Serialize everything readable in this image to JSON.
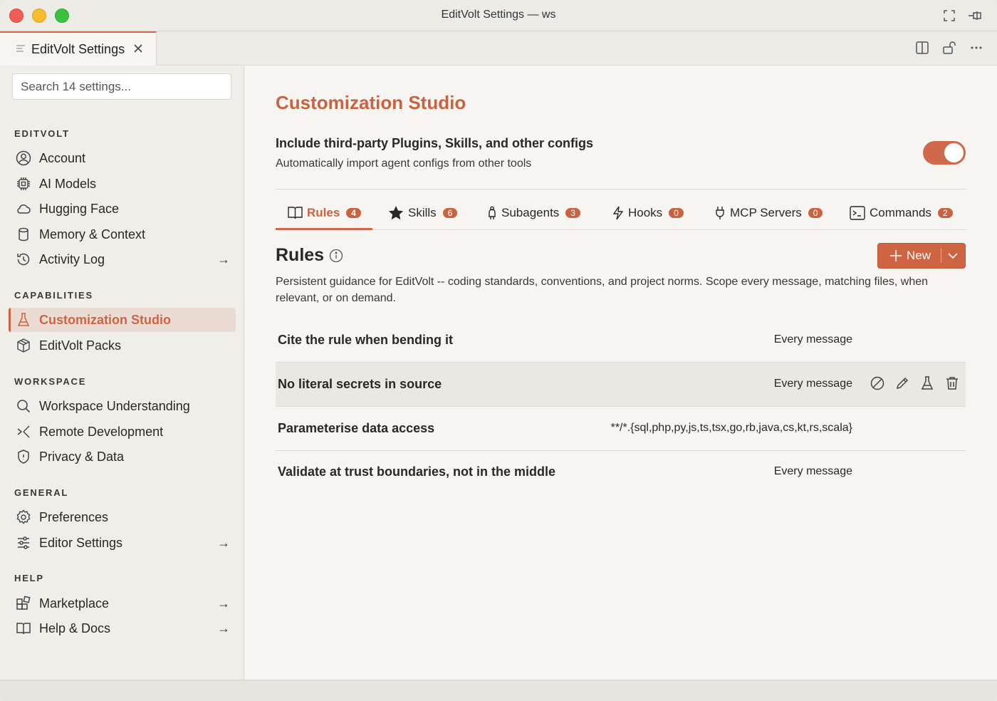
{
  "window": {
    "title": "EditVolt Settings — ws"
  },
  "editor_tab": {
    "label": "EditVolt Settings"
  },
  "sidebar": {
    "search_placeholder": "Search 14 settings...",
    "sections": [
      {
        "label": "EDITVOLT",
        "items": [
          {
            "label": "Account",
            "icon": "account-circle-icon"
          },
          {
            "label": "AI Models",
            "icon": "chip-icon"
          },
          {
            "label": "Hugging Face",
            "icon": "cloud-icon"
          },
          {
            "label": "Memory & Context",
            "icon": "database-icon"
          },
          {
            "label": "Activity Log",
            "icon": "history-icon",
            "arrow": "→"
          }
        ]
      },
      {
        "label": "CAPABILITIES",
        "items": [
          {
            "label": "Customization Studio",
            "icon": "flask-icon",
            "active": true
          },
          {
            "label": "EditVolt Packs",
            "icon": "package-icon"
          }
        ]
      },
      {
        "label": "WORKSPACE",
        "items": [
          {
            "label": "Workspace Understanding",
            "icon": "search-icon"
          },
          {
            "label": "Remote Development",
            "icon": "remote-icon"
          },
          {
            "label": "Privacy & Data",
            "icon": "shield-icon"
          }
        ]
      },
      {
        "label": "GENERAL",
        "items": [
          {
            "label": "Preferences",
            "icon": "gear-icon"
          },
          {
            "label": "Editor Settings",
            "icon": "sliders-icon",
            "arrow": "→"
          }
        ]
      },
      {
        "label": "HELP",
        "items": [
          {
            "label": "Marketplace",
            "icon": "extensions-icon",
            "arrow": "→"
          },
          {
            "label": "Help & Docs",
            "icon": "book-icon",
            "arrow": "→"
          }
        ]
      }
    ]
  },
  "main": {
    "title": "Customization Studio",
    "option": {
      "title": "Include third-party Plugins, Skills, and other configs",
      "description": "Automatically import agent configs from other tools",
      "enabled": true
    },
    "tabs": [
      {
        "label": "Rules",
        "count": "4",
        "icon": "book-icon",
        "active": true
      },
      {
        "label": "Skills",
        "count": "6",
        "icon": "star-icon"
      },
      {
        "label": "Subagents",
        "count": "3",
        "icon": "subagent-icon"
      },
      {
        "label": "Hooks",
        "count": "0",
        "icon": "lightning-icon"
      },
      {
        "label": "MCP Servers",
        "count": "0",
        "icon": "plug-icon"
      },
      {
        "label": "Commands",
        "count": "2",
        "icon": "terminal-icon"
      }
    ],
    "rules": {
      "title": "Rules",
      "new_label": "New",
      "description": "Persistent guidance for EditVolt -- coding standards, conventions, and project norms. Scope every message, matching files, when relevant, or on demand.",
      "items": [
        {
          "name": "Cite the rule when bending it",
          "scope": "Every message"
        },
        {
          "name": "No literal secrets in source",
          "scope": "Every message",
          "hovered": true
        },
        {
          "name": "Parameterise data access",
          "scope": "**/*.{sql,php,py,js,ts,tsx,go,rb,java,cs,kt,rs,scala}"
        },
        {
          "name": "Validate at trust boundaries, not in the middle",
          "scope": "Every message"
        }
      ]
    }
  },
  "colors": {
    "accent": "#cf6443",
    "sidebar_bg": "#f0eee9",
    "main_bg": "#f7f5f1"
  }
}
